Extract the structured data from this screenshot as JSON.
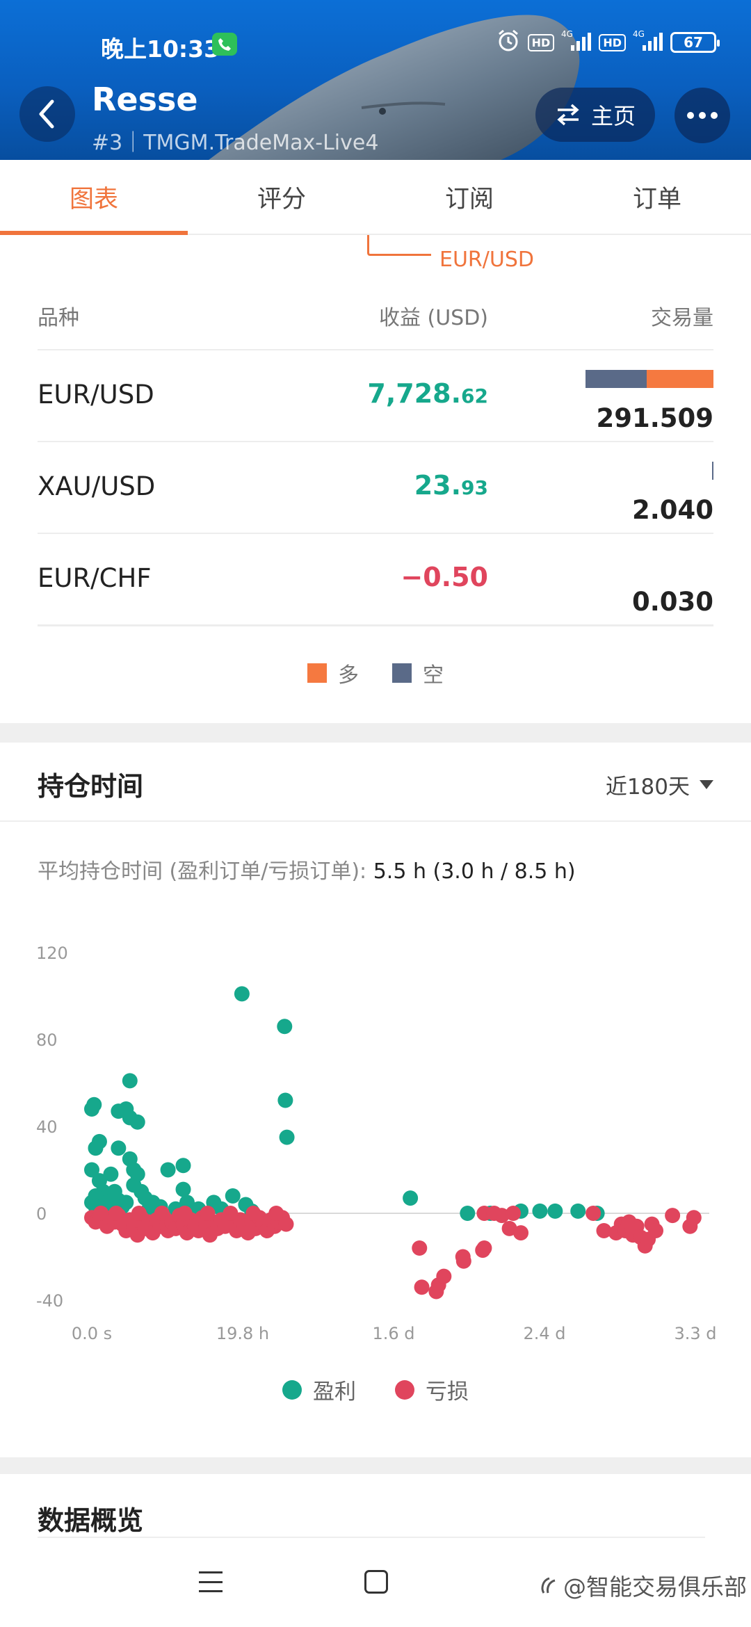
{
  "status_bar": {
    "time": "晚上10:33",
    "battery": "67",
    "network_labels": [
      "HD",
      "4G",
      "HD",
      "4G"
    ]
  },
  "header": {
    "trader_name": "Resse",
    "subtitle": "#3｜TMGM.TradeMax-Live4",
    "home_button": "主页"
  },
  "tabs": [
    {
      "label": "图表",
      "active": true
    },
    {
      "label": "评分",
      "active": false
    },
    {
      "label": "订阅",
      "active": false
    },
    {
      "label": "订单",
      "active": false
    }
  ],
  "symbols": {
    "peek_label": "EUR/USD",
    "headers": {
      "symbol": "品种",
      "profit": "收益 (USD)",
      "volume": "交易量"
    },
    "rows": [
      {
        "symbol": "EUR/USD",
        "profit_main": "7,728.",
        "profit_dec": "62",
        "sign": "pos",
        "volume": "291.509",
        "short_share": 0.48,
        "long_share": 0.52,
        "bar_scale": 1.0
      },
      {
        "symbol": "XAU/USD",
        "profit_main": "23.",
        "profit_dec": "93",
        "sign": "pos",
        "volume": "2.040",
        "short_share": 1.0,
        "long_share": 0.0,
        "bar_scale": 0.007
      },
      {
        "symbol": "EUR/CHF",
        "profit_main": "−0.50",
        "profit_dec": "",
        "sign": "neg",
        "volume": "0.030",
        "short_share": 0.0,
        "long_share": 0.0,
        "bar_scale": 0.0
      }
    ],
    "legend": {
      "long": "多",
      "short": "空"
    },
    "colors": {
      "long": "#f57940",
      "short": "#5a6a88"
    }
  },
  "holding": {
    "title": "持仓时间",
    "range": "近180天",
    "avg_label": "平均持仓时间 (盈利订单/亏损订单): ",
    "avg_value": "5.5 h (3.0 h / 8.5 h)",
    "legend": {
      "profit": "盈利",
      "loss": "亏损"
    },
    "colors": {
      "profit": "#16a88c",
      "loss": "#e0455d"
    }
  },
  "chart_data": {
    "type": "scatter",
    "x_unit": "hours",
    "x_ticks": [
      {
        "label": "0.0 s",
        "value": 0
      },
      {
        "label": "19.8 h",
        "value": 19.8
      },
      {
        "label": "1.6 d",
        "value": 39.6
      },
      {
        "label": "2.4 d",
        "value": 59.4
      },
      {
        "label": "3.3 d",
        "value": 79.2
      }
    ],
    "y_ticks": [
      120,
      80,
      40,
      0,
      -40
    ],
    "xlim": [
      0,
      79.2
    ],
    "ylim": [
      -40,
      120
    ],
    "grid": false,
    "zero_line": true,
    "legend_position": "bottom",
    "series": [
      {
        "name": "盈利",
        "points": [
          [
            0.0,
            48
          ],
          [
            0.3,
            50
          ],
          [
            0.5,
            30
          ],
          [
            1.0,
            33
          ],
          [
            0.0,
            20
          ],
          [
            1.5,
            10
          ],
          [
            2.0,
            5
          ],
          [
            0.0,
            5
          ],
          [
            0.5,
            8
          ],
          [
            1.0,
            15
          ],
          [
            2.5,
            18
          ],
          [
            3.0,
            10
          ],
          [
            3.5,
            6
          ],
          [
            4.5,
            5
          ],
          [
            3.5,
            47
          ],
          [
            4.5,
            48
          ],
          [
            5.0,
            61
          ],
          [
            5.0,
            44
          ],
          [
            6.0,
            42
          ],
          [
            3.5,
            30
          ],
          [
            5.0,
            25
          ],
          [
            5.5,
            20
          ],
          [
            6.0,
            18
          ],
          [
            5.5,
            13
          ],
          [
            6.5,
            10
          ],
          [
            7.0,
            7
          ],
          [
            8.0,
            5
          ],
          [
            10.0,
            20
          ],
          [
            12.0,
            22
          ],
          [
            12.0,
            11
          ],
          [
            12.5,
            5
          ],
          [
            16.0,
            5
          ],
          [
            18.5,
            8
          ],
          [
            20.2,
            4
          ],
          [
            19.7,
            101
          ],
          [
            25.3,
            86
          ],
          [
            25.4,
            52
          ],
          [
            25.6,
            35
          ],
          [
            0.5,
            3
          ],
          [
            2.0,
            2
          ],
          [
            4.0,
            3
          ],
          [
            7.5,
            2
          ],
          [
            9.0,
            3
          ],
          [
            11.0,
            2
          ],
          [
            14.0,
            2
          ],
          [
            17.0,
            2
          ],
          [
            21.0,
            1
          ],
          [
            41.8,
            7
          ],
          [
            49.3,
            0
          ],
          [
            52.3,
            0
          ],
          [
            56.3,
            1
          ],
          [
            58.8,
            1
          ],
          [
            60.8,
            1
          ],
          [
            63.8,
            1
          ],
          [
            66.3,
            0
          ]
        ]
      },
      {
        "name": "亏损",
        "points": [
          [
            0.0,
            -2
          ],
          [
            0.5,
            -4
          ],
          [
            1.0,
            -1
          ],
          [
            1.5,
            -3
          ],
          [
            2.0,
            -6
          ],
          [
            2.5,
            -2
          ],
          [
            3.0,
            -4
          ],
          [
            3.5,
            -1
          ],
          [
            4.0,
            -5
          ],
          [
            4.5,
            -8
          ],
          [
            5.0,
            -3
          ],
          [
            5.5,
            -6
          ],
          [
            6.0,
            -10
          ],
          [
            6.5,
            -2
          ],
          [
            7.0,
            -7
          ],
          [
            7.5,
            -4
          ],
          [
            8.0,
            -9
          ],
          [
            8.5,
            -3
          ],
          [
            9.0,
            -6
          ],
          [
            9.5,
            -2
          ],
          [
            10.0,
            -8
          ],
          [
            10.5,
            -4
          ],
          [
            11.0,
            -7
          ],
          [
            11.5,
            -1
          ],
          [
            12.0,
            -5
          ],
          [
            12.5,
            -9
          ],
          [
            13.0,
            -3
          ],
          [
            13.5,
            -6
          ],
          [
            14.0,
            -8
          ],
          [
            14.5,
            -2
          ],
          [
            15.0,
            -5
          ],
          [
            15.5,
            -10
          ],
          [
            16.0,
            -4
          ],
          [
            16.5,
            -7
          ],
          [
            17.0,
            -3
          ],
          [
            17.5,
            -6
          ],
          [
            18.0,
            -2
          ],
          [
            18.5,
            -5
          ],
          [
            19.0,
            -8
          ],
          [
            19.5,
            -3
          ],
          [
            20.0,
            -6
          ],
          [
            20.5,
            -9
          ],
          [
            21.0,
            -4
          ],
          [
            21.5,
            -7
          ],
          [
            22.0,
            -2
          ],
          [
            22.5,
            -5
          ],
          [
            23.0,
            -8
          ],
          [
            23.5,
            -3
          ],
          [
            24.0,
            -6
          ],
          [
            24.5,
            -4
          ],
          [
            25.0,
            -2
          ],
          [
            25.5,
            -5
          ],
          [
            1.2,
            0
          ],
          [
            3.2,
            0
          ],
          [
            6.2,
            0
          ],
          [
            9.2,
            0
          ],
          [
            12.2,
            0
          ],
          [
            15.2,
            0
          ],
          [
            18.2,
            0
          ],
          [
            21.2,
            0
          ],
          [
            24.2,
            0
          ],
          [
            43.0,
            -16
          ],
          [
            43.3,
            -34
          ],
          [
            45.2,
            -36
          ],
          [
            45.5,
            -33
          ],
          [
            46.2,
            -29
          ],
          [
            48.8,
            -22
          ],
          [
            48.7,
            -20
          ],
          [
            51.3,
            -17
          ],
          [
            51.5,
            -16
          ],
          [
            51.5,
            0
          ],
          [
            52.8,
            0
          ],
          [
            53.8,
            -1
          ],
          [
            54.8,
            -7
          ],
          [
            55.3,
            0
          ],
          [
            56.3,
            -9
          ],
          [
            65.8,
            0
          ],
          [
            67.2,
            -8
          ],
          [
            68.8,
            -9
          ],
          [
            69.5,
            -5
          ],
          [
            70.0,
            -8
          ],
          [
            70.5,
            -4
          ],
          [
            71.0,
            -10
          ],
          [
            71.5,
            -6
          ],
          [
            72.0,
            -11
          ],
          [
            72.6,
            -15
          ],
          [
            73.0,
            -12
          ],
          [
            73.5,
            -5
          ],
          [
            74.0,
            -8
          ],
          [
            76.2,
            -1
          ],
          [
            78.5,
            -6
          ],
          [
            79.0,
            -2
          ]
        ]
      }
    ]
  },
  "overview": {
    "title": "数据概览"
  },
  "watermark": "@智能交易俱乐部"
}
